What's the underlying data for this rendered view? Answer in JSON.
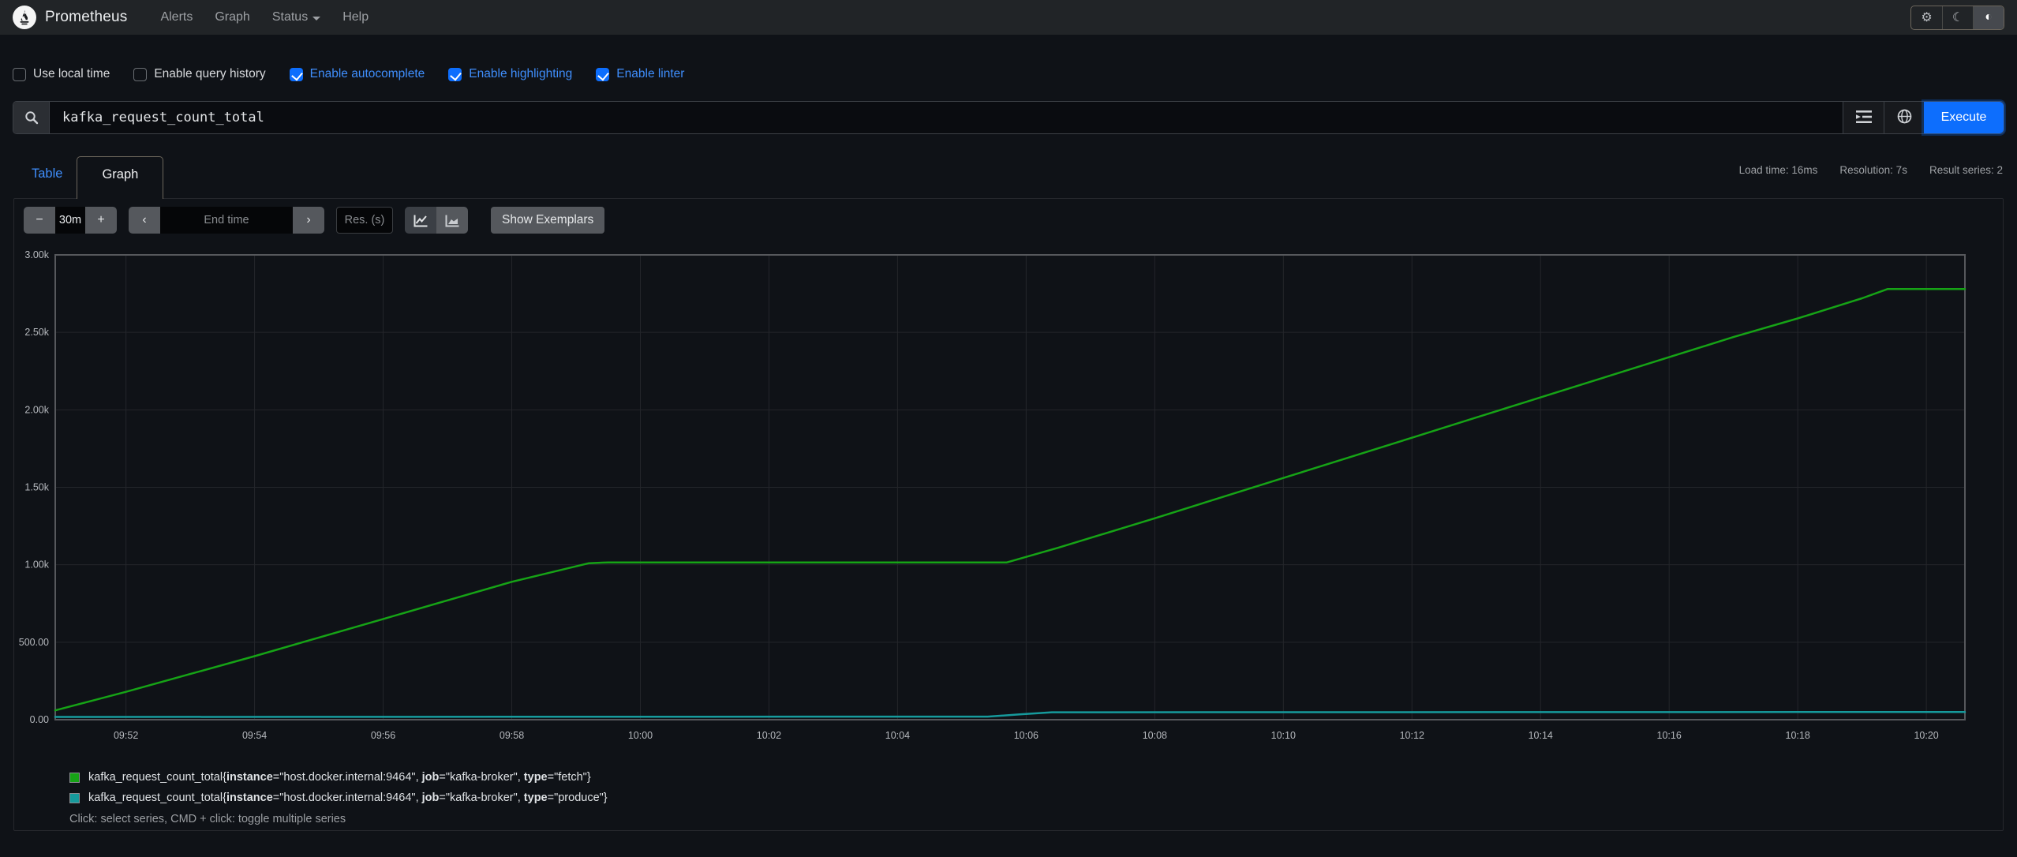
{
  "navbar": {
    "brand": "Prometheus",
    "links": [
      {
        "label": "Alerts"
      },
      {
        "label": "Graph"
      },
      {
        "label": "Status",
        "dropdown": true
      },
      {
        "label": "Help"
      }
    ],
    "theme_icons": {
      "settings": "⚙",
      "dark": "☾",
      "auto": "◐"
    }
  },
  "options": {
    "items": [
      {
        "label": "Use local time",
        "checked": false
      },
      {
        "label": "Enable query history",
        "checked": false
      },
      {
        "label": "Enable autocomplete",
        "checked": true
      },
      {
        "label": "Enable highlighting",
        "checked": true
      },
      {
        "label": "Enable linter",
        "checked": true
      }
    ]
  },
  "query": {
    "value": "kafka_request_count_total",
    "execute_label": "Execute"
  },
  "stats": {
    "load_time": "Load time: 16ms",
    "resolution": "Resolution: 7s",
    "result_series": "Result series: 2"
  },
  "tabs": {
    "table": "Table",
    "graph": "Graph"
  },
  "toolbar": {
    "minus_label": "−",
    "plus_label": "+",
    "range_value": "30m",
    "chevron_left": "‹",
    "chevron_right": "›",
    "end_time_placeholder": "End time",
    "res_placeholder": "Res. (s)",
    "show_exemplars": "Show Exemplars"
  },
  "chart_data": {
    "type": "line",
    "title": "",
    "xlabel": "",
    "ylabel": "",
    "grid": true,
    "legend_position": "bottom",
    "x_unit": "minutes_since_midnight",
    "x_range": [
      590.9,
      620.6
    ],
    "y_range": [
      0,
      3000
    ],
    "x_ticks": [
      {
        "t": 592,
        "label": "09:52"
      },
      {
        "t": 594,
        "label": "09:54"
      },
      {
        "t": 596,
        "label": "09:56"
      },
      {
        "t": 598,
        "label": "09:58"
      },
      {
        "t": 600,
        "label": "10:00"
      },
      {
        "t": 602,
        "label": "10:02"
      },
      {
        "t": 604,
        "label": "10:04"
      },
      {
        "t": 606,
        "label": "10:06"
      },
      {
        "t": 608,
        "label": "10:08"
      },
      {
        "t": 610,
        "label": "10:10"
      },
      {
        "t": 612,
        "label": "10:12"
      },
      {
        "t": 614,
        "label": "10:14"
      },
      {
        "t": 616,
        "label": "10:16"
      },
      {
        "t": 618,
        "label": "10:18"
      },
      {
        "t": 620,
        "label": "10:20"
      }
    ],
    "y_ticks": [
      {
        "v": 0,
        "label": "0.00"
      },
      {
        "v": 500,
        "label": "500.00"
      },
      {
        "v": 1000,
        "label": "1.00k"
      },
      {
        "v": 1500,
        "label": "1.50k"
      },
      {
        "v": 2000,
        "label": "2.00k"
      },
      {
        "v": 2500,
        "label": "2.50k"
      },
      {
        "v": 3000,
        "label": "3.00k"
      }
    ],
    "series": [
      {
        "name": "kafka_request_count_total{instance=\"host.docker.internal:9464\", job=\"kafka-broker\", type=\"fetch\"}",
        "color": "#16a316",
        "points": [
          [
            590.9,
            60
          ],
          [
            592,
            180
          ],
          [
            593,
            295
          ],
          [
            594,
            410
          ],
          [
            595,
            530
          ],
          [
            596,
            650
          ],
          [
            597,
            770
          ],
          [
            598,
            890
          ],
          [
            599.2,
            1010
          ],
          [
            599.5,
            1015
          ],
          [
            605.7,
            1015
          ],
          [
            606.5,
            1110
          ],
          [
            608,
            1300
          ],
          [
            609,
            1430
          ],
          [
            610,
            1560
          ],
          [
            611,
            1690
          ],
          [
            612,
            1820
          ],
          [
            613,
            1950
          ],
          [
            614,
            2080
          ],
          [
            615,
            2210
          ],
          [
            616,
            2340
          ],
          [
            617,
            2470
          ],
          [
            618,
            2590
          ],
          [
            619,
            2720
          ],
          [
            619.4,
            2780
          ],
          [
            620.6,
            2780
          ]
        ]
      },
      {
        "name": "kafka_request_count_total{instance=\"host.docker.internal:9464\", job=\"kafka-broker\", type=\"produce\"}",
        "color": "#169a9c",
        "points": [
          [
            590.9,
            18
          ],
          [
            605.4,
            20
          ],
          [
            605.9,
            34
          ],
          [
            606.4,
            48
          ],
          [
            620.6,
            50
          ]
        ]
      }
    ]
  },
  "legend": {
    "hint": "Click: select series, CMD + click: toggle multiple series"
  },
  "colors": {
    "accent_blue": "#0d6efd",
    "link_blue": "#3f8efc",
    "series_fetch": "#16a316",
    "series_produce": "#169a9c",
    "plot_border": "#56585c",
    "gridline": "#24262b"
  }
}
